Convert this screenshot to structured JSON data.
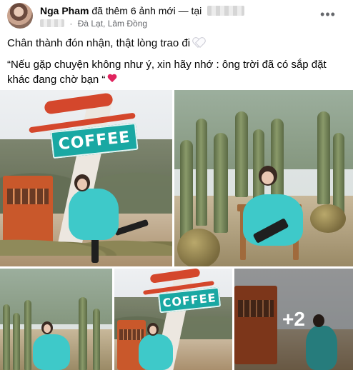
{
  "post": {
    "author": "Nga Pham",
    "action": "đã thêm 6 ảnh mới — tại",
    "location": "Đà Lạt, Lâm Đồng",
    "privacy_icon": "globe-icon",
    "more_icon": "more-options-icon",
    "line1": "Chân thành đón nhận, thật lòng trao đi",
    "line2": "“Nếu gặp chuyện không như ý, xin hãy nhớ : ông trời đã có sắp đặt khác đang chờ bạn “",
    "photos": {
      "sign_text_1": "COFFEE",
      "sign_text_2": "COFFEE",
      "more_count": "+2"
    }
  },
  "colors": {
    "text": "#050505",
    "meta": "#65676b",
    "teal": "#19a8a3",
    "heart_red": "#e0245e"
  }
}
